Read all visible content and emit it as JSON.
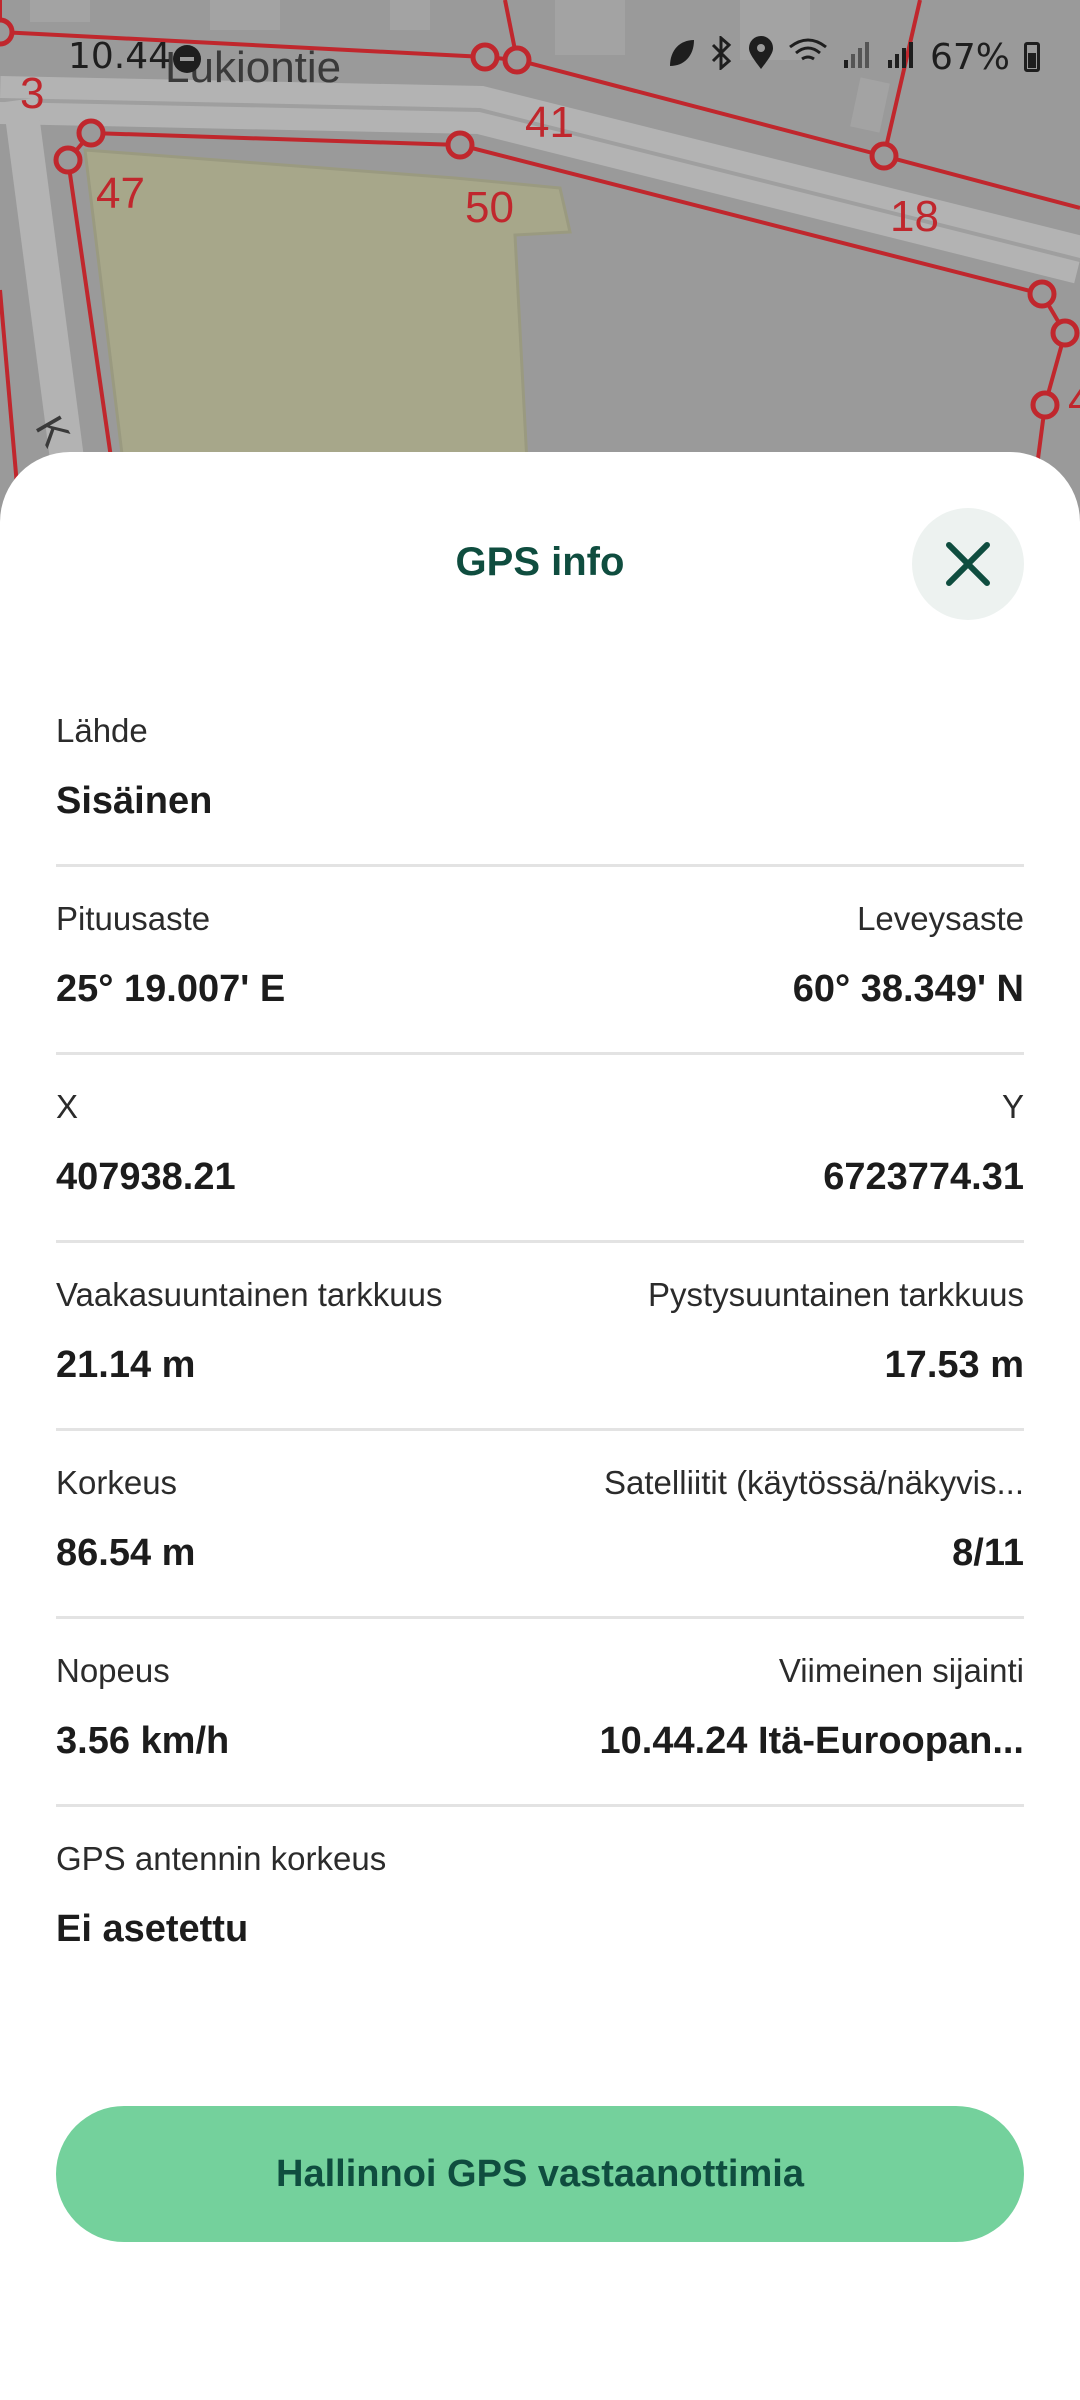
{
  "status_bar": {
    "time": "10.44",
    "battery": "67%",
    "icons": [
      "dnd-icon",
      "leaf-icon",
      "bluetooth-icon",
      "location-icon",
      "wifi-icon",
      "signal-icon",
      "signal-icon",
      "battery-icon"
    ]
  },
  "map": {
    "street_name": "Lukiontie",
    "street_partial": "K",
    "parcel_numbers": [
      "3",
      "41",
      "47",
      "50",
      "18",
      "4"
    ],
    "colors": {
      "background": "#9a9a9a",
      "parcel_line": "#c0272d",
      "parcel_fill": "#a7a78a",
      "road": "#b3b3b3"
    }
  },
  "sheet": {
    "title": "GPS info",
    "close_icon": "close-icon",
    "source": {
      "label": "Lähde",
      "value": "Sisäinen"
    },
    "longitude": {
      "label": "Pituusaste",
      "value": "25° 19.007' E"
    },
    "latitude": {
      "label": "Leveysaste",
      "value": "60° 38.349' N"
    },
    "x": {
      "label": "X",
      "value": "407938.21"
    },
    "y": {
      "label": "Y",
      "value": "6723774.31"
    },
    "horizontal_accuracy": {
      "label": "Vaakasuuntainen tarkkuus",
      "value": "21.14 m"
    },
    "vertical_accuracy": {
      "label": "Pystysuuntainen tarkkuus",
      "value": "17.53 m"
    },
    "altitude": {
      "label": "Korkeus",
      "value": "86.54 m"
    },
    "satellites": {
      "label": "Satelliitit (käytössä/näkyvis...",
      "value": "8/11"
    },
    "speed": {
      "label": "Nopeus",
      "value": "3.56 km/h"
    },
    "last_location": {
      "label": "Viimeinen sijainti",
      "value": "10.44.24 Itä-Euroopan..."
    },
    "antenna_height": {
      "label": "GPS antennin korkeus",
      "value": "Ei asetettu"
    },
    "manage_button": "Hallinnoi GPS vastaanottimia"
  },
  "colors": {
    "accent": "#74d19c",
    "title": "#0f4d3f",
    "close_bg": "#edf2f0"
  }
}
